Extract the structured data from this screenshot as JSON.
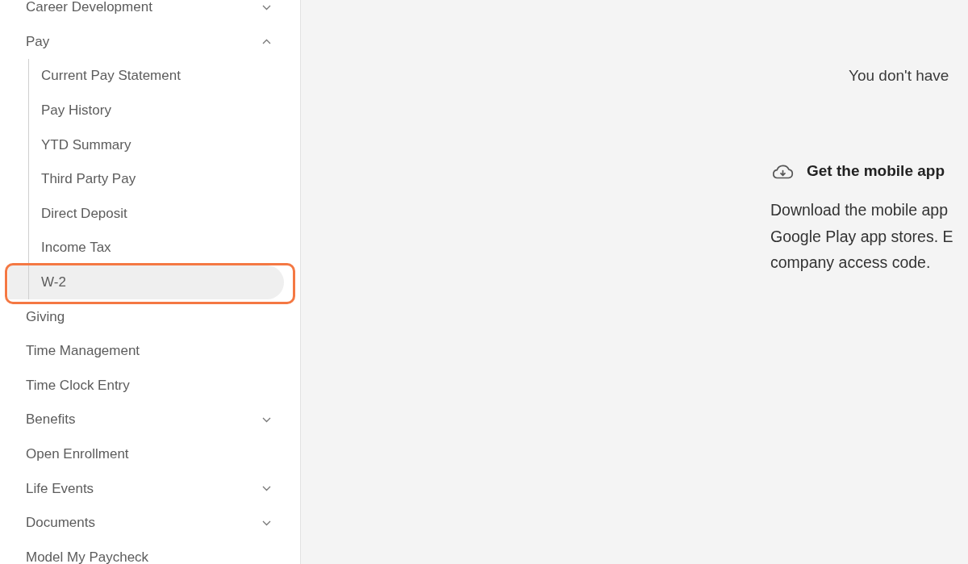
{
  "sidebar": {
    "items": [
      {
        "label": "Career Development",
        "kind": "group",
        "expanded": false,
        "selected": false,
        "highlighted": false
      },
      {
        "label": "Pay",
        "kind": "group",
        "expanded": true,
        "selected": false,
        "highlighted": false,
        "children": [
          {
            "label": "Current Pay Statement",
            "selected": false,
            "highlighted": false
          },
          {
            "label": "Pay History",
            "selected": false,
            "highlighted": false
          },
          {
            "label": "YTD Summary",
            "selected": false,
            "highlighted": false
          },
          {
            "label": "Third Party Pay",
            "selected": false,
            "highlighted": false
          },
          {
            "label": "Direct Deposit",
            "selected": false,
            "highlighted": false
          },
          {
            "label": "Income Tax",
            "selected": false,
            "highlighted": false
          },
          {
            "label": "W-2",
            "selected": true,
            "highlighted": true
          }
        ]
      },
      {
        "label": "Giving",
        "kind": "link",
        "selected": false,
        "highlighted": false
      },
      {
        "label": "Time Management",
        "kind": "link",
        "selected": false,
        "highlighted": false
      },
      {
        "label": "Time Clock Entry",
        "kind": "link",
        "selected": false,
        "highlighted": false
      },
      {
        "label": "Benefits",
        "kind": "group",
        "expanded": false,
        "selected": false,
        "highlighted": false
      },
      {
        "label": "Open Enrollment",
        "kind": "link",
        "selected": false,
        "highlighted": false
      },
      {
        "label": "Life Events",
        "kind": "group",
        "expanded": false,
        "selected": false,
        "highlighted": false
      },
      {
        "label": "Documents",
        "kind": "group",
        "expanded": false,
        "selected": false,
        "highlighted": false
      },
      {
        "label": "Model My Paycheck",
        "kind": "link",
        "selected": false,
        "highlighted": false
      }
    ]
  },
  "main": {
    "message": "You don't have",
    "mobile_app": {
      "title": "Get the mobile app",
      "description_lines": [
        "Download the mobile app",
        "Google Play app stores. E",
        "company access code."
      ]
    }
  }
}
